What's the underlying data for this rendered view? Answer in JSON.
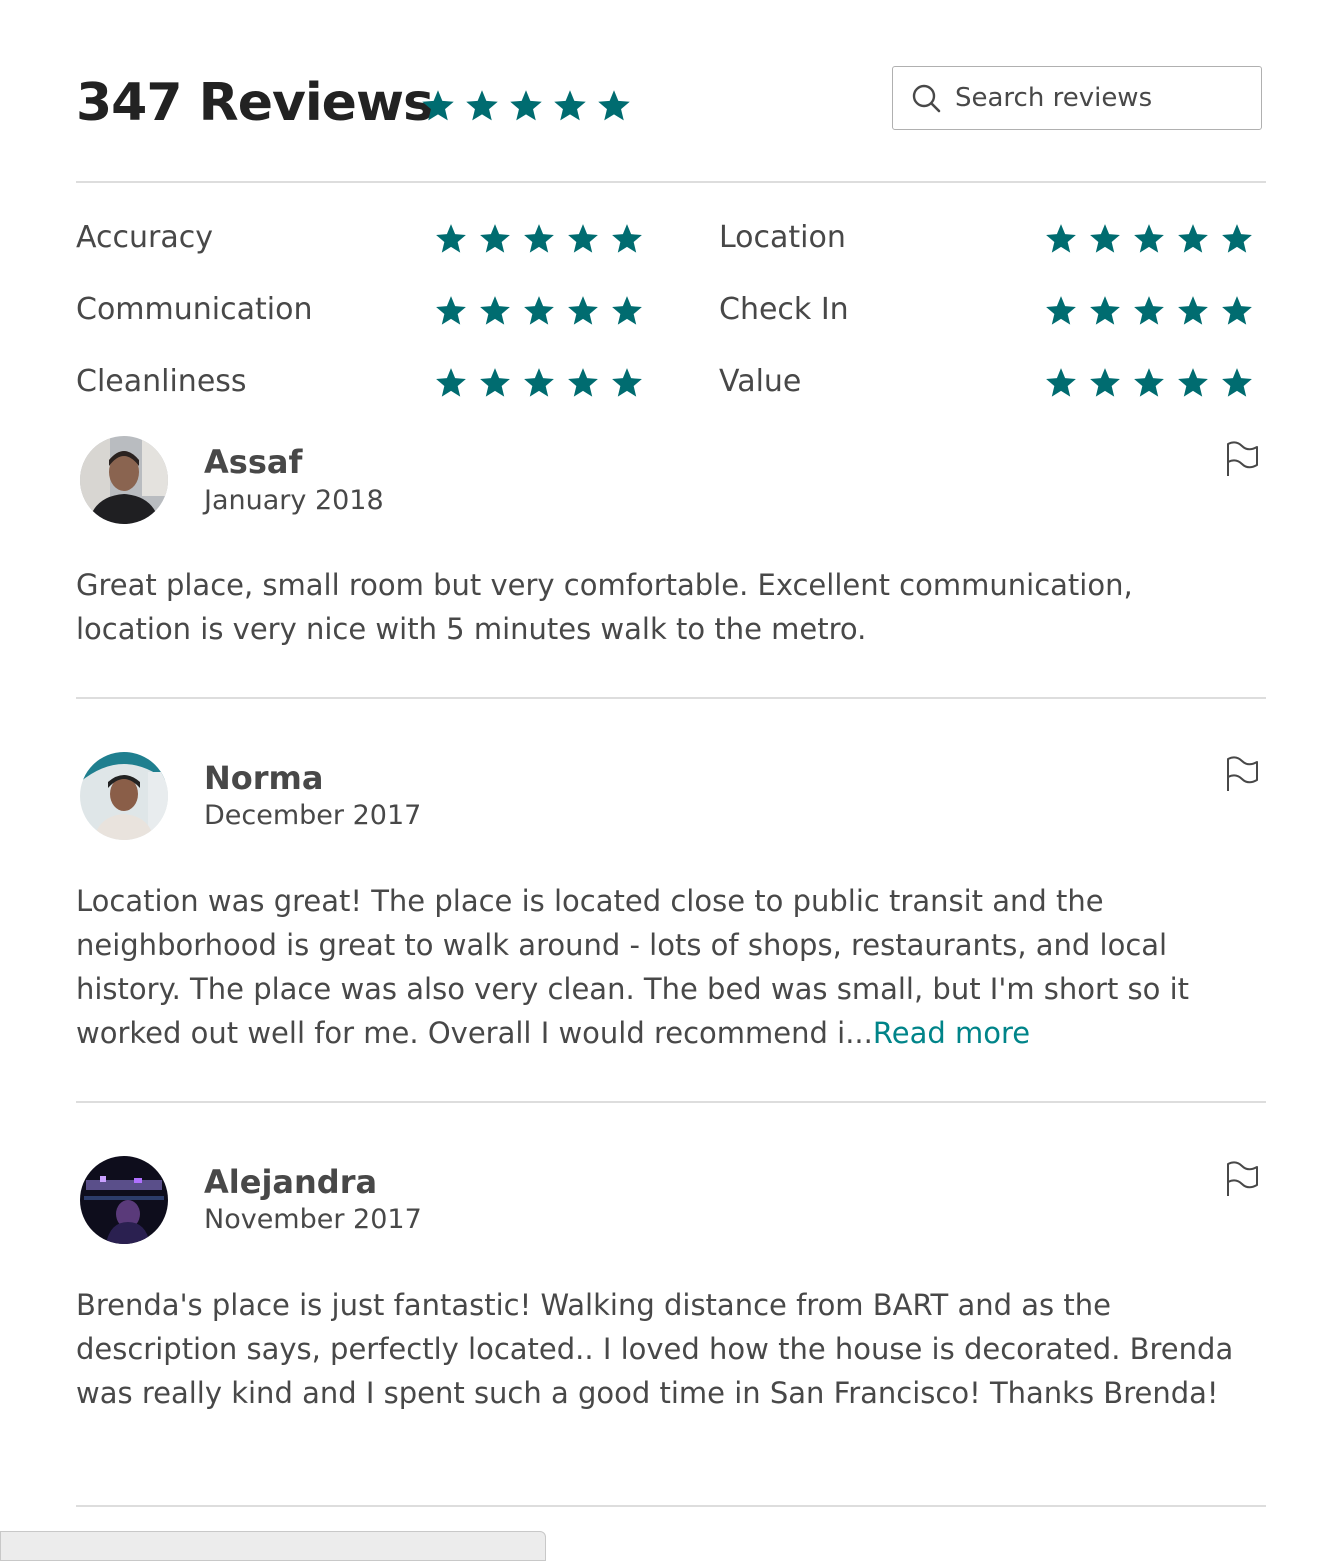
{
  "header": {
    "title": "347 Reviews",
    "overall_rating_stars": 5,
    "accent_color": "#006c70"
  },
  "search": {
    "placeholder": "Search reviews",
    "icon": "search-icon"
  },
  "categories": [
    {
      "label": "Accuracy",
      "stars": 5
    },
    {
      "label": "Location",
      "stars": 5
    },
    {
      "label": "Communication",
      "stars": 5
    },
    {
      "label": "Check In",
      "stars": 5
    },
    {
      "label": "Cleanliness",
      "stars": 5
    },
    {
      "label": "Value",
      "stars": 5
    }
  ],
  "reviews": [
    {
      "name": "Assaf",
      "date": "January 2018",
      "text": "Great place, small room but very comfortable. Excellent communication, location is very nice with 5 minutes walk to the metro.",
      "read_more": ""
    },
    {
      "name": "Norma",
      "date": "December 2017",
      "text": "Location was great! The place is located close to public transit and the neighborhood is great to walk around - lots of shops, restaurants, and local history. The place was also very clean. The bed was small, but I'm short so it worked out well for me. Overall I would recommend i...",
      "read_more": "Read more"
    },
    {
      "name": "Alejandra",
      "date": "November 2017",
      "text": "Brenda's place is just fantastic! Walking distance from BART and as the description says, perfectly located.. I loved how the house is decorated. Brenda was really kind and I spent such a good time in San Francisco! Thanks Brenda!",
      "read_more": ""
    }
  ]
}
